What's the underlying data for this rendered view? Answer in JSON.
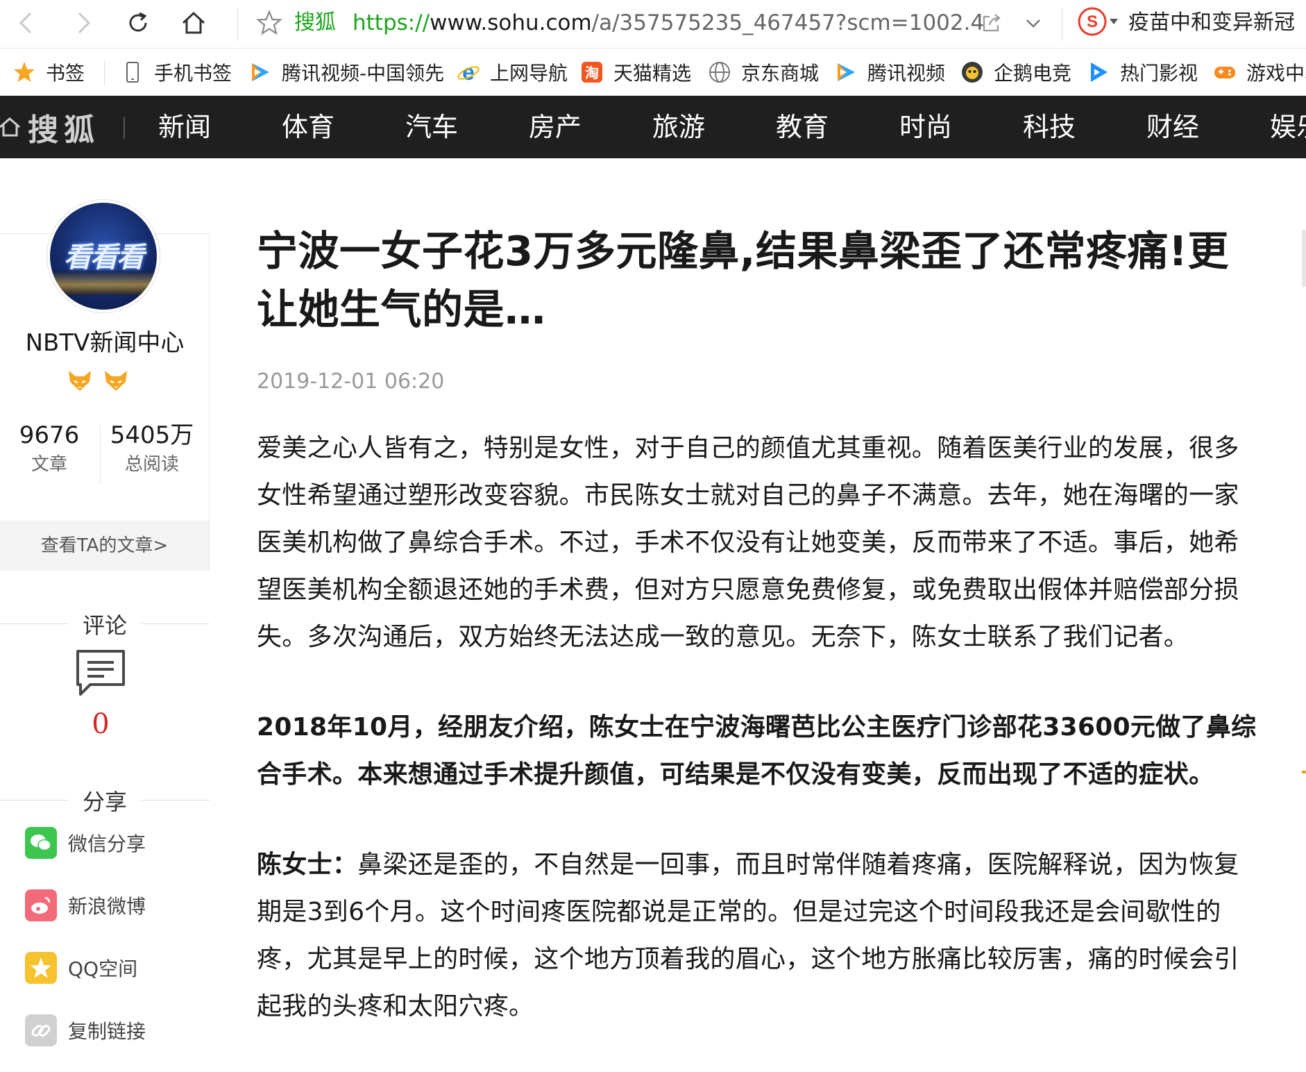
{
  "browser": {
    "site_name": "搜狐",
    "url_protocol": "https://",
    "url_host": "www.sohu.com",
    "url_path": "/a/357575235_467457?scm=1002.4",
    "search_hint": "疫苗中和变异新冠"
  },
  "bookmarks": [
    {
      "label": "书签",
      "icon": "star-icon"
    },
    {
      "label": "手机书签",
      "icon": "phone-icon"
    },
    {
      "label": "腾讯视频-中国领先",
      "icon": "tencent-video-icon"
    },
    {
      "label": "上网导航",
      "icon": "ie-icon"
    },
    {
      "label": "天猫精选",
      "icon": "tmall-icon"
    },
    {
      "label": "京东商城",
      "icon": "globe-icon"
    },
    {
      "label": "腾讯视频",
      "icon": "tencent-video-icon"
    },
    {
      "label": "企鹅电竞",
      "icon": "penguin-esports-icon"
    },
    {
      "label": "热门影视",
      "icon": "video-play-icon"
    },
    {
      "label": "游戏中心",
      "icon": "gamepad-icon"
    }
  ],
  "sohu_header": {
    "logo": "搜狐",
    "nav": [
      "新闻",
      "体育",
      "汽车",
      "房产",
      "旅游",
      "教育",
      "时尚",
      "科技",
      "财经",
      "娱乐"
    ]
  },
  "author": {
    "avatar_text": "看看看",
    "name": "NBTV新闻中心",
    "articles_count": "9676",
    "articles_label": "文章",
    "reads_count": "5405万",
    "reads_label": "总阅读",
    "link": "查看TA的文章>"
  },
  "side": {
    "comment_title": "评论",
    "comment_count": "0",
    "share_title": "分享",
    "share_items": [
      "微信分享",
      "新浪微博",
      "QQ空间",
      "复制链接"
    ]
  },
  "article": {
    "title": "宁波一女子花3万多元隆鼻,结果鼻梁歪了还常疼痛!更让她生气的是…",
    "time": "2019-12-01 06:20",
    "p1": "爱美之心人皆有之，特别是女性，对于自己的颜值尤其重视。随着医美行业的发展，很多女性希望通过塑形改变容貌。市民陈女士就对自己的鼻子不满意。去年，她在海曙的一家医美机构做了鼻综合手术。不过，手术不仅没有让她变美，反而带来了不适。事后，她希望医美机构全额退还她的手术费，但对方只愿意免费修复，或免费取出假体并赔偿部分损失。多次沟通后，双方始终无法达成一致的意见。无奈下，陈女士联系了我们记者。",
    "p2": "2018年10月，经朋友介绍，陈女士在宁波海曙芭比公主医疗门诊部花33600元做了鼻综合手术。本来想通过手术提升颜值，可结果是不仅没有变美，反而出现了不适的症状。",
    "p3_speaker": "陈女士：",
    "p3": "鼻梁还是歪的，不自然是一回事，而且时常伴随着疼痛，医院解释说，因为恢复期是3到6个月。这个时间疼医院都说是正常的。但是过完这个时间段我还是会间歇性的疼，尤其是早上的时候，这个地方顶着我的眉心，这个地方胀痛比较厉害，痛的时候会引起我的头疼和太阳穴疼。"
  },
  "colors": {
    "accent_green": "#1aa61a",
    "header_bg": "#1f1f1f",
    "comment_red": "#d42828"
  }
}
